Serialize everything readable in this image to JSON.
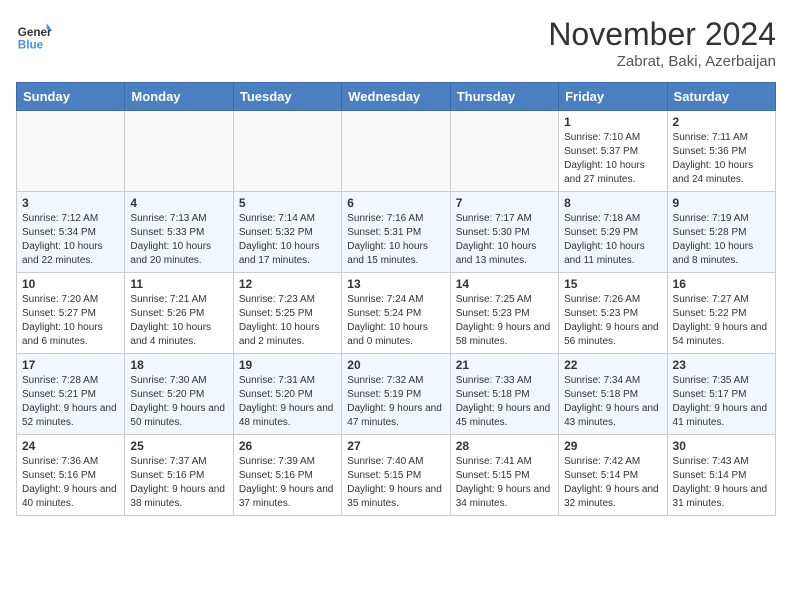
{
  "header": {
    "logo_line1": "General",
    "logo_line2": "Blue",
    "month": "November 2024",
    "location": "Zabrat, Baki, Azerbaijan"
  },
  "weekdays": [
    "Sunday",
    "Monday",
    "Tuesday",
    "Wednesday",
    "Thursday",
    "Friday",
    "Saturday"
  ],
  "weeks": [
    [
      {
        "day": "",
        "info": ""
      },
      {
        "day": "",
        "info": ""
      },
      {
        "day": "",
        "info": ""
      },
      {
        "day": "",
        "info": ""
      },
      {
        "day": "",
        "info": ""
      },
      {
        "day": "1",
        "info": "Sunrise: 7:10 AM\nSunset: 5:37 PM\nDaylight: 10 hours\nand 27 minutes."
      },
      {
        "day": "2",
        "info": "Sunrise: 7:11 AM\nSunset: 5:36 PM\nDaylight: 10 hours\nand 24 minutes."
      }
    ],
    [
      {
        "day": "3",
        "info": "Sunrise: 7:12 AM\nSunset: 5:34 PM\nDaylight: 10 hours\nand 22 minutes."
      },
      {
        "day": "4",
        "info": "Sunrise: 7:13 AM\nSunset: 5:33 PM\nDaylight: 10 hours\nand 20 minutes."
      },
      {
        "day": "5",
        "info": "Sunrise: 7:14 AM\nSunset: 5:32 PM\nDaylight: 10 hours\nand 17 minutes."
      },
      {
        "day": "6",
        "info": "Sunrise: 7:16 AM\nSunset: 5:31 PM\nDaylight: 10 hours\nand 15 minutes."
      },
      {
        "day": "7",
        "info": "Sunrise: 7:17 AM\nSunset: 5:30 PM\nDaylight: 10 hours\nand 13 minutes."
      },
      {
        "day": "8",
        "info": "Sunrise: 7:18 AM\nSunset: 5:29 PM\nDaylight: 10 hours\nand 11 minutes."
      },
      {
        "day": "9",
        "info": "Sunrise: 7:19 AM\nSunset: 5:28 PM\nDaylight: 10 hours\nand 8 minutes."
      }
    ],
    [
      {
        "day": "10",
        "info": "Sunrise: 7:20 AM\nSunset: 5:27 PM\nDaylight: 10 hours\nand 6 minutes."
      },
      {
        "day": "11",
        "info": "Sunrise: 7:21 AM\nSunset: 5:26 PM\nDaylight: 10 hours\nand 4 minutes."
      },
      {
        "day": "12",
        "info": "Sunrise: 7:23 AM\nSunset: 5:25 PM\nDaylight: 10 hours\nand 2 minutes."
      },
      {
        "day": "13",
        "info": "Sunrise: 7:24 AM\nSunset: 5:24 PM\nDaylight: 10 hours\nand 0 minutes."
      },
      {
        "day": "14",
        "info": "Sunrise: 7:25 AM\nSunset: 5:23 PM\nDaylight: 9 hours\nand 58 minutes."
      },
      {
        "day": "15",
        "info": "Sunrise: 7:26 AM\nSunset: 5:23 PM\nDaylight: 9 hours\nand 56 minutes."
      },
      {
        "day": "16",
        "info": "Sunrise: 7:27 AM\nSunset: 5:22 PM\nDaylight: 9 hours\nand 54 minutes."
      }
    ],
    [
      {
        "day": "17",
        "info": "Sunrise: 7:28 AM\nSunset: 5:21 PM\nDaylight: 9 hours\nand 52 minutes."
      },
      {
        "day": "18",
        "info": "Sunrise: 7:30 AM\nSunset: 5:20 PM\nDaylight: 9 hours\nand 50 minutes."
      },
      {
        "day": "19",
        "info": "Sunrise: 7:31 AM\nSunset: 5:20 PM\nDaylight: 9 hours\nand 48 minutes."
      },
      {
        "day": "20",
        "info": "Sunrise: 7:32 AM\nSunset: 5:19 PM\nDaylight: 9 hours\nand 47 minutes."
      },
      {
        "day": "21",
        "info": "Sunrise: 7:33 AM\nSunset: 5:18 PM\nDaylight: 9 hours\nand 45 minutes."
      },
      {
        "day": "22",
        "info": "Sunrise: 7:34 AM\nSunset: 5:18 PM\nDaylight: 9 hours\nand 43 minutes."
      },
      {
        "day": "23",
        "info": "Sunrise: 7:35 AM\nSunset: 5:17 PM\nDaylight: 9 hours\nand 41 minutes."
      }
    ],
    [
      {
        "day": "24",
        "info": "Sunrise: 7:36 AM\nSunset: 5:16 PM\nDaylight: 9 hours\nand 40 minutes."
      },
      {
        "day": "25",
        "info": "Sunrise: 7:37 AM\nSunset: 5:16 PM\nDaylight: 9 hours\nand 38 minutes."
      },
      {
        "day": "26",
        "info": "Sunrise: 7:39 AM\nSunset: 5:16 PM\nDaylight: 9 hours\nand 37 minutes."
      },
      {
        "day": "27",
        "info": "Sunrise: 7:40 AM\nSunset: 5:15 PM\nDaylight: 9 hours\nand 35 minutes."
      },
      {
        "day": "28",
        "info": "Sunrise: 7:41 AM\nSunset: 5:15 PM\nDaylight: 9 hours\nand 34 minutes."
      },
      {
        "day": "29",
        "info": "Sunrise: 7:42 AM\nSunset: 5:14 PM\nDaylight: 9 hours\nand 32 minutes."
      },
      {
        "day": "30",
        "info": "Sunrise: 7:43 AM\nSunset: 5:14 PM\nDaylight: 9 hours\nand 31 minutes."
      }
    ]
  ]
}
